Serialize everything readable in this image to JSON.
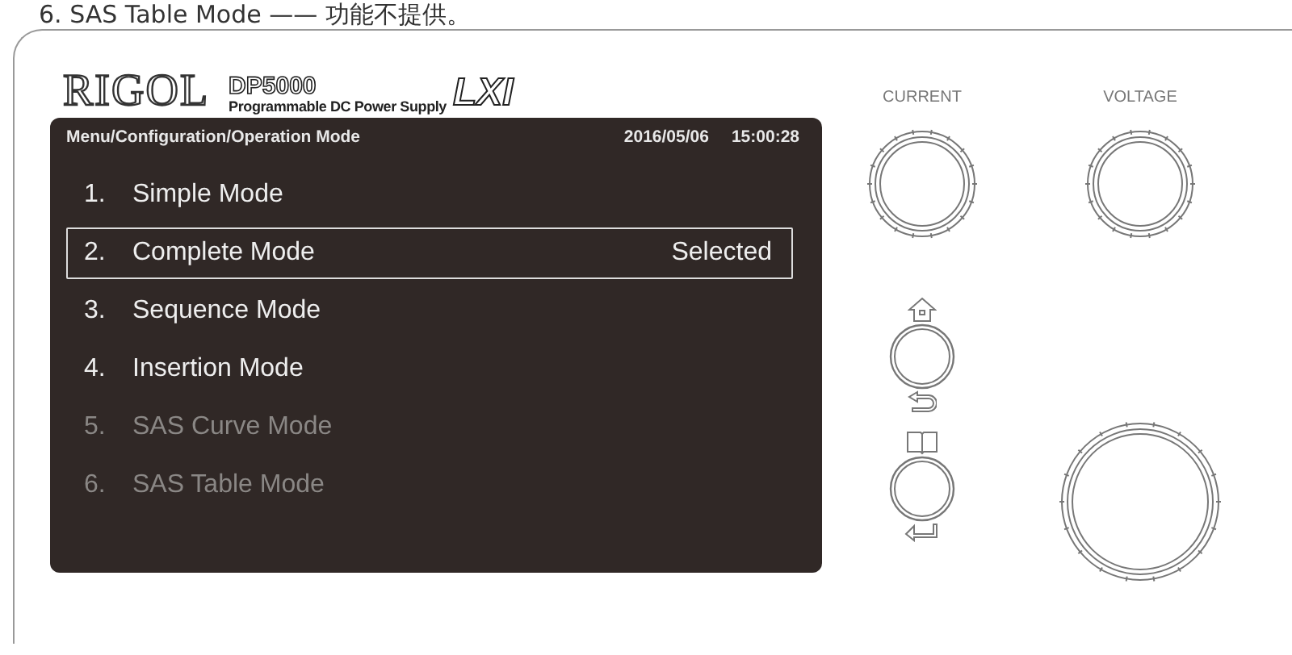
{
  "caption": "6. SAS Table Mode —— 功能不提供。",
  "logo": {
    "brand": "RIGOL",
    "model": "DP5000",
    "subtitle": "Programmable DC Power Supply",
    "badge": "LXI"
  },
  "screen": {
    "path": "Menu/Configuration/Operation Mode",
    "date": "2016/05/06",
    "time": "15:00:28",
    "items": [
      {
        "number": "1.",
        "label": "Simple Mode",
        "selected": false,
        "disabled": false
      },
      {
        "number": "2.",
        "label": "Complete Mode",
        "selected": true,
        "disabled": false,
        "status": "Selected"
      },
      {
        "number": "3.",
        "label": "Sequence Mode",
        "selected": false,
        "disabled": false
      },
      {
        "number": "4.",
        "label": "Insertion Mode",
        "selected": false,
        "disabled": false
      },
      {
        "number": "5.",
        "label": "SAS Curve Mode",
        "selected": false,
        "disabled": true
      },
      {
        "number": "6.",
        "label": "SAS Table Mode",
        "selected": false,
        "disabled": true
      }
    ]
  },
  "knobs": {
    "current_label": "CURRENT",
    "voltage_label": "VOLTAGE"
  }
}
